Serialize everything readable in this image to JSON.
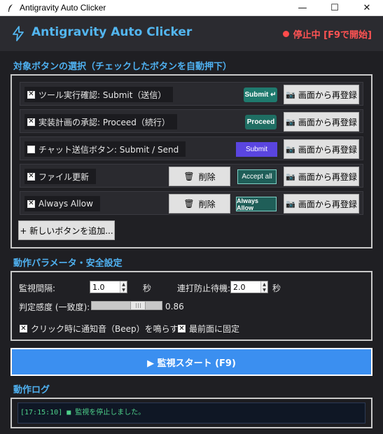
{
  "window": {
    "title": "Antigravity Auto Clicker",
    "controls": [
      "—",
      "☐",
      "✕"
    ]
  },
  "header": {
    "title": "Antigravity Auto Clicker",
    "status": "停止中 [F9で開始]",
    "status_color": "#ff4b4b",
    "accent": "#53b6f0"
  },
  "targets": {
    "section_title": "対象ボタンの選択（チェックしたボタンを自動押下）",
    "register_label": "画面から再登録",
    "delete_label": "削除",
    "add_label": "+ 新しいボタンを追加...",
    "rows": [
      {
        "label": "ツール実行確認: Submit（送信）",
        "checked": true,
        "preview": "Submit ↵",
        "preview_color": "#1f7a6e"
      },
      {
        "label": "実装計画の承認: Proceed（続行）",
        "checked": true,
        "preview": "Proceed",
        "preview_color": "#1f6e63"
      },
      {
        "label": "チャット送信ボタン: Submit / Send",
        "checked": false,
        "preview": "Submit",
        "preview_color": "#5a45e0"
      },
      {
        "label": "ファイル更新",
        "checked": true,
        "preview": "Accept all",
        "preview_color": "#1f5e58"
      },
      {
        "label": "Always Allow",
        "checked": true,
        "preview": "Always Allow",
        "preview_color": "#1f5e58"
      }
    ]
  },
  "params": {
    "section_title": "動作パラメータ・安全設定",
    "interval_label": "監視間隔:",
    "interval_value": "1.0",
    "interval_unit": "秒",
    "cooldown_label": "連打防止待機:",
    "cooldown_value": "2.0",
    "cooldown_unit": "秒",
    "threshold_label": "判定感度 (一致度):",
    "threshold_value": "0.86",
    "threshold_level": 0.86,
    "beep_label": "クリック時に通知音（Beep）を鳴らす",
    "beep_checked": true,
    "topmost_label": "最前面に固定",
    "topmost_checked": true
  },
  "start_button": "▶ 監視スタート (F9)",
  "log": {
    "section_title": "動作ログ",
    "lines": [
      "[17:15:10] ■ 監視を停止しました。"
    ]
  }
}
